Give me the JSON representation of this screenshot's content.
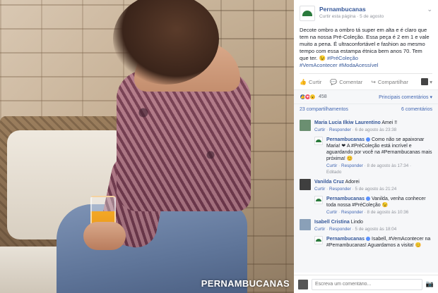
{
  "photo": {
    "watermark": "PERNAMBUCANAS"
  },
  "post": {
    "page_name": "Pernambucanas",
    "meta_action": "Curtir esta página",
    "meta_sep": " · ",
    "meta_date": "5 de agosto",
    "text": "Decote ombro a ombro tá super em alta e é claro que tem na nossa Pré-Coleção. Essa peça é 2 em 1 e vale muito a pena. É ultraconfortável e fashion ao mesmo tempo com essa estampa étnica bem anos 70. Tem que ter. 😉 ",
    "inline_hashtag": "#PréColeção",
    "hashtags": "#VemAcontecer #ModaAcessível"
  },
  "actions": {
    "like": "Curtir",
    "comment": "Comentar",
    "share": "Compartilhar"
  },
  "reactions": {
    "count": "458",
    "sort_label": "Principais comentários ▾"
  },
  "shares": {
    "shares_text": "23 compartilhamentos",
    "comments_text": "6 comentários"
  },
  "comments": [
    {
      "name": "Maria Lucia Ilkiw Laurentino",
      "text": "Amei !!",
      "like": "Curtir",
      "reply": "Responder",
      "time": "6 de agosto às 23:38",
      "avatar_color": "#6b8f71",
      "replies": [
        {
          "name": "Pernambucanas",
          "text_before": "Como não se apaixonar Maria! ❤ A ",
          "tag": "#PréColeção",
          "text_mid": " está incrível e aguardando por você na ",
          "tag2": "#Pernambucanas",
          "text_after": " mais próxima! 😊",
          "like": "Curtir",
          "reply": "Responder",
          "time": "8 de agosto às 17:34 ·",
          "edited": "Editado"
        }
      ]
    },
    {
      "name": "Vanilda Cruz",
      "text": "Adorei",
      "like": "Curtir",
      "reply": "Responder",
      "time": "5 de agosto às 21:24",
      "avatar_color": "#3f3f3f",
      "replies": [
        {
          "name": "Pernambucanas",
          "text_before": "Vanilda, venha conhecer toda nossa ",
          "tag": "#PréColeção",
          "text_mid": " 😉",
          "tag2": "",
          "text_after": "",
          "like": "Curtir",
          "reply": "Responder",
          "time": "8 de agosto às 10:36",
          "edited": ""
        }
      ]
    },
    {
      "name": "Isabell Cristina",
      "text": "Lindo",
      "like": "Curtir",
      "reply": "Responder",
      "time": "5 de agosto às 18:04",
      "avatar_color": "#8aa0b8",
      "replies": [
        {
          "name": "Pernambucanas",
          "text_before": "Isabell, ",
          "tag": "#VemAcontecer",
          "text_mid": " na ",
          "tag2": "#Pernambucanas",
          "text_after": "! Aguardamos a visita! 😊",
          "like": "",
          "reply": "",
          "time": "",
          "edited": ""
        }
      ]
    }
  ],
  "composer": {
    "placeholder": "Escreva um comentário..."
  }
}
